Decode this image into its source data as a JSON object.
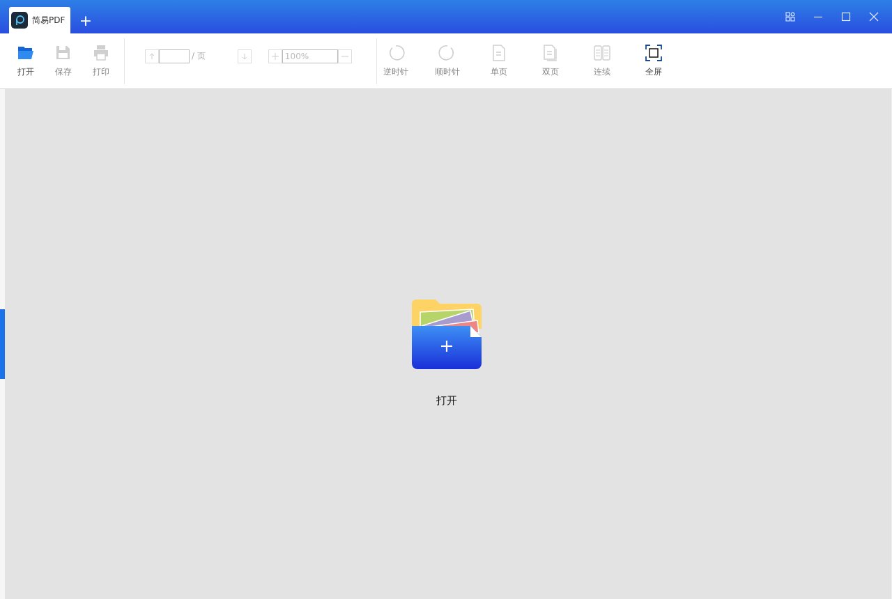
{
  "window": {
    "tabs": [
      {
        "label": "简易PDF",
        "selected": true
      }
    ],
    "new_tab": "+"
  },
  "toolbar": {
    "file_buttons": [
      {
        "kind": "open",
        "label": "打开",
        "disabled": false
      },
      {
        "kind": "save",
        "label": "保存",
        "disabled": true
      },
      {
        "kind": "print",
        "label": "打印",
        "disabled": true
      }
    ],
    "page_nav": {
      "disabled": true,
      "page_suffix": "/ 页",
      "zoom_value": "100%"
    },
    "view_buttons": [
      {
        "kind": "rotate-left",
        "label": "逆时针",
        "disabled": true
      },
      {
        "kind": "rotate-right",
        "label": "顺时针",
        "disabled": true
      },
      {
        "kind": "single",
        "label": "单页",
        "disabled": true
      },
      {
        "kind": "double",
        "label": "双页",
        "disabled": true
      },
      {
        "kind": "continuous",
        "label": "连续",
        "disabled": true
      },
      {
        "kind": "fullscreen",
        "label": "全屏",
        "disabled": false
      }
    ]
  },
  "canvas": {
    "open_label": "打开"
  }
}
